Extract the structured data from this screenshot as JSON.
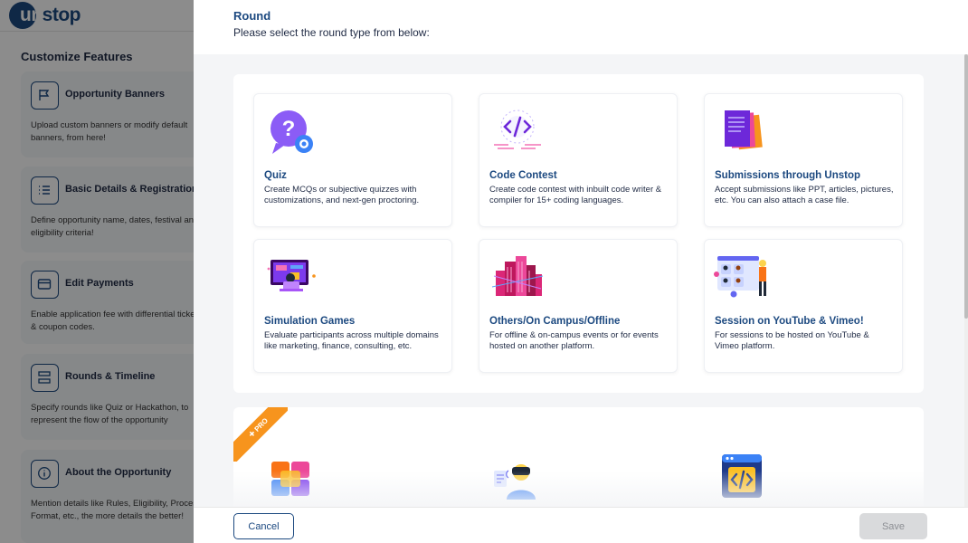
{
  "brand": {
    "logo_text_first": "un",
    "logo_text_rest": "stop"
  },
  "sidebar": {
    "title": "Customize Features",
    "cards": [
      {
        "icon": "flag-icon",
        "title": "Opportunity Banners",
        "desc": "Upload custom banners or modify default banners, from here!"
      },
      {
        "icon": "list-icon",
        "title": "Basic Details & Registrations",
        "desc": "Define opportunity name, dates, festival and eligibility criteria!"
      },
      {
        "icon": "card-icon",
        "title": "Edit Payments",
        "desc": "Enable application fee with differential ticketing & coupon codes."
      },
      {
        "icon": "timeline-icon",
        "title": "Rounds & Timeline",
        "desc": "Specify rounds like Quiz or Hackathon, to represent the flow of the opportunity"
      },
      {
        "icon": "info-icon",
        "title": "About the Opportunity",
        "desc": "Mention details like Rules, Eligibility, Process, Format, etc., the more details the better!"
      }
    ]
  },
  "modal": {
    "title": "Round",
    "subtitle": "Please select the round type from below:",
    "rounds": [
      {
        "icon": "quiz-icon",
        "title": "Quiz",
        "desc": "Create MCQs or subjective quizzes with customizations, and next-gen proctoring."
      },
      {
        "icon": "code-icon",
        "title": "Code Contest",
        "desc": "Create code contest with inbuilt code writer & compiler for 15+ coding languages."
      },
      {
        "icon": "documents-icon",
        "title": "Submissions through Unstop",
        "desc": "Accept submissions like PPT, articles, pictures, etc. You can also attach a case file."
      },
      {
        "icon": "simulation-icon",
        "title": "Simulation Games",
        "desc": "Evaluate participants across multiple domains like marketing, finance, consulting, etc."
      },
      {
        "icon": "city-icon",
        "title": "Others/On Campus/Offline",
        "desc": "For offline & on-campus events or for events hosted on another platform."
      },
      {
        "icon": "video-call-icon",
        "title": "Session on YouTube & Vimeo!",
        "desc": "For sessions to be hosted on YouTube & Vimeo platform."
      }
    ],
    "pro_badge": "PRO",
    "pro_rounds": [
      {
        "icon": "cube-icon"
      },
      {
        "icon": "vr-headset-icon"
      },
      {
        "icon": "code-window-icon"
      }
    ],
    "cancel_label": "Cancel",
    "save_label": "Save"
  },
  "colors": {
    "brand_blue": "#1c4980",
    "pro_orange": "#f7941d",
    "purple": "#7a3fe0"
  }
}
